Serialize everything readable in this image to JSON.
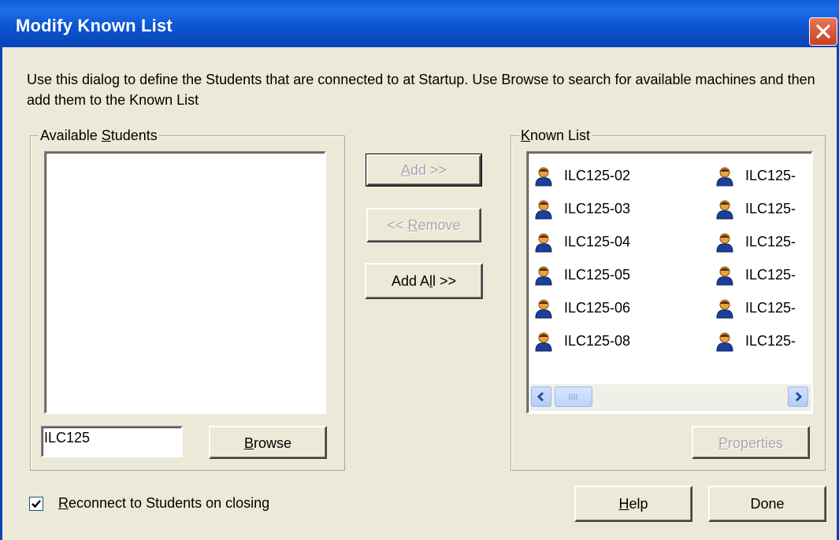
{
  "window": {
    "title": "Modify Known List"
  },
  "description": "Use this dialog to define the Students that are connected to at Startup. Use Browse to search for available machines and then add them to the Known List",
  "available": {
    "group_title_pre": "Available ",
    "group_title_ul": "S",
    "group_title_post": "tudents",
    "input_value": "ILC125",
    "browse_ul": "B",
    "browse_post": "rowse"
  },
  "middle_buttons": {
    "add_ul": "A",
    "add_post": "dd >>",
    "remove_pre": "<< ",
    "remove_ul": "R",
    "remove_post": "emove",
    "addall_pre": "Add A",
    "addall_ul": "l",
    "addall_post": "l >>"
  },
  "known": {
    "group_title_ul": "K",
    "group_title_post": "nown List",
    "col1": [
      "ILC125-02",
      "ILC125-03",
      "ILC125-04",
      "ILC125-05",
      "ILC125-06",
      "ILC125-08"
    ],
    "col2": [
      "ILC125-",
      "ILC125-",
      "ILC125-",
      "ILC125-",
      "ILC125-",
      "ILC125-"
    ],
    "properties_ul": "P",
    "properties_post": "roperties"
  },
  "footer": {
    "checkbox_checked": true,
    "checkbox_label_ul": "R",
    "checkbox_label_post": "econnect to Students on closing",
    "help_ul": "H",
    "help_post": "elp",
    "done_label": "Done"
  }
}
